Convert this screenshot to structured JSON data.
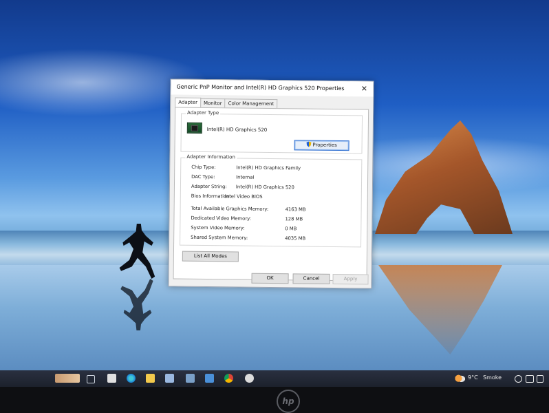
{
  "dialog": {
    "title": "Generic PnP Monitor and Intel(R) HD Graphics 520 Properties",
    "close_label": "✕",
    "tabs": [
      "Adapter",
      "Monitor",
      "Color Management"
    ],
    "active_tab": "Adapter",
    "adapter_type": {
      "group_label": "Adapter Type",
      "name": "Intel(R) HD Graphics 520",
      "properties_button": "Properties"
    },
    "adapter_info": {
      "group_label": "Adapter Information",
      "rows": [
        {
          "label": "Chip Type:",
          "value": "Intel(R) HD Graphics Family"
        },
        {
          "label": "DAC Type:",
          "value": "Internal"
        },
        {
          "label": "Adapter String:",
          "value": "Intel(R) HD Graphics 520"
        },
        {
          "label": "Bios Information:",
          "value": "Intel Video BIOS"
        }
      ]
    },
    "memory": [
      {
        "label": "Total Available Graphics Memory:",
        "value": "4163 MB"
      },
      {
        "label": "Dedicated Video Memory:",
        "value": "128 MB"
      },
      {
        "label": "System Video Memory:",
        "value": "0 MB"
      },
      {
        "label": "Shared System Memory:",
        "value": "4035 MB"
      }
    ],
    "list_modes_button": "List All Modes",
    "ok_button": "OK",
    "cancel_button": "Cancel",
    "apply_button": "Apply"
  },
  "taskbar": {
    "icons": [
      "task-view-icon",
      "file-icon",
      "edge-icon",
      "explorer-icon",
      "store-icon",
      "app-icon",
      "monitor-icon",
      "chrome-icon",
      "settings-icon"
    ],
    "weather": {
      "temperature": "9°C",
      "condition": "Smoke"
    }
  },
  "laptop": {
    "brand": "hp"
  },
  "colors": {
    "accent": "#2f6fd1",
    "taskbar": "#1c212c"
  }
}
